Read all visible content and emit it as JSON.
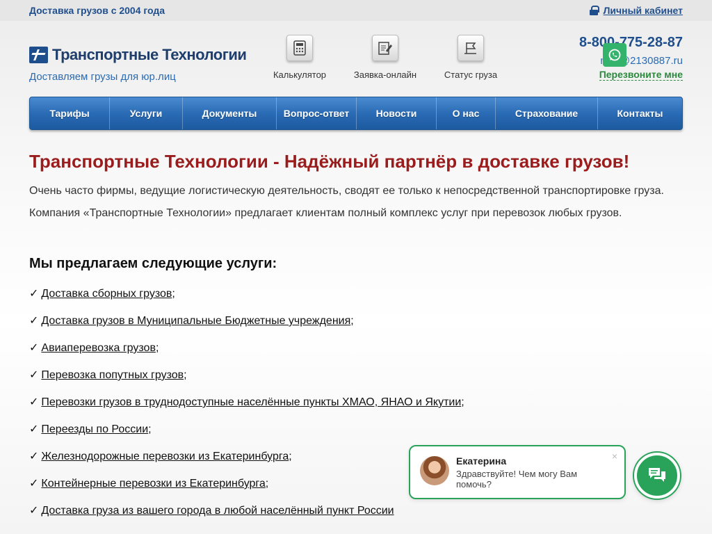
{
  "topbar": {
    "since": "Доставка грузов с 2004 года",
    "cabinet": "Личный кабинет"
  },
  "header": {
    "logo_text": "Транспортные Технологии",
    "tagline": "Доставляем грузы для юр.лиц",
    "quick": [
      {
        "label": "Калькулятор",
        "icon": "calculator-icon"
      },
      {
        "label": "Заявка-онлайн",
        "icon": "edit-form-icon"
      },
      {
        "label": "Статус груза",
        "icon": "flag-icon"
      }
    ],
    "phone": "8-800-775-28-87",
    "mail": "mail@2130887.ru",
    "callback": "Перезвоните мне"
  },
  "nav": [
    "Тарифы",
    "Услуги",
    "Документы",
    "Вопрос-ответ",
    "Новости",
    "О нас",
    "Страхование",
    "Контакты"
  ],
  "main": {
    "title": "Транспортные Технологии - Надёжный партнёр в доставке грузов!",
    "p1": "Очень часто фирмы, ведущие логистическую деятельность, сводят ее только к непосредственной транспортировке груза.",
    "p2": "Компания «Транспортные Технологии» предлагает клиентам полный комплекс услуг при перевозок любых грузов.",
    "services_title": "Мы предлагаем следующие услуги:",
    "check": "✓",
    "services": [
      {
        "link": "Доставка сборных грузов",
        "suffix": ";"
      },
      {
        "link": "Доставка грузов в Муниципальные Бюджетные учреждения",
        "suffix": ";"
      },
      {
        "link": "Авиаперевозка грузов",
        "suffix": ";"
      },
      {
        "link": "Перевозка попутных грузов",
        "suffix": ";"
      },
      {
        "link": "Перевозки грузов в труднодоступные населённые пункты ХМАО, ЯНАО и Якутии",
        "suffix": ";"
      },
      {
        "link": "Переезды по России",
        "suffix": ";"
      },
      {
        "link": "Железнодорожные перевозки из Екатеринбурга",
        "suffix": ";"
      },
      {
        "link": "Контейнерные перевозки из Екатеринбурга",
        "suffix": ";"
      },
      {
        "link": "Доставка груза из вашего города в любой населённый пункт России",
        "suffix": ""
      }
    ]
  },
  "chat": {
    "name": "Екатерина",
    "message": "Здравствуйте! Чем могу Вам помочь?",
    "close": "×"
  },
  "colors": {
    "brand": "#1f4e8c",
    "accent_red": "#9b1c1c",
    "green": "#2aa35a"
  }
}
